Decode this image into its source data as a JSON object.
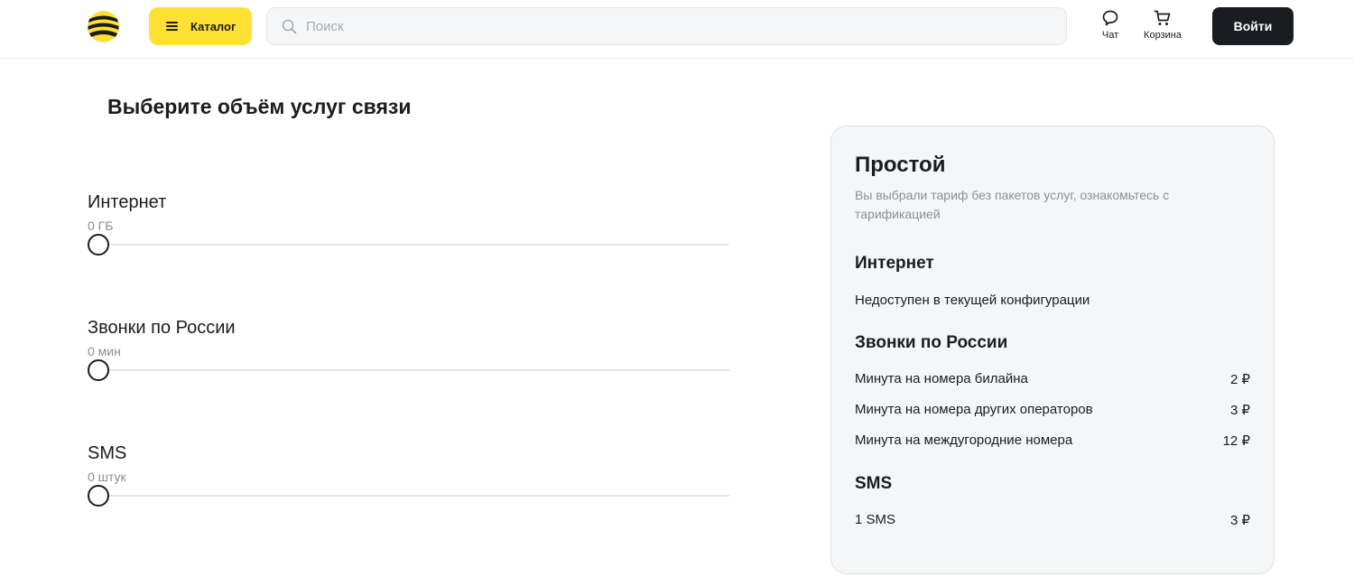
{
  "header": {
    "catalog_label": "Каталог",
    "search_placeholder": "Поиск",
    "chat_label": "Чат",
    "cart_label": "Корзина",
    "login_label": "Войти",
    "brand_colors": {
      "yellow": "#ffe033",
      "black": "#191c20"
    }
  },
  "main": {
    "title": "Выберите объём услуг связи",
    "sliders": [
      {
        "name": "Интернет",
        "value": "0 ГБ",
        "level": 0
      },
      {
        "name": "Звонки по России",
        "value": "0 мин",
        "level": 0
      },
      {
        "name": "SMS",
        "value": "0 штук",
        "level": 0
      }
    ]
  },
  "summary": {
    "title": "Простой",
    "subtitle": "Вы выбрали тариф без пакетов услуг, ознакомьтесь с тарификацией",
    "internet": {
      "heading": "Интернет",
      "note": "Недоступен в текущей конфигурации"
    },
    "calls": {
      "heading": "Звонки по России",
      "rows": [
        {
          "label": "Минута на номера билайна",
          "price": "2 ₽"
        },
        {
          "label": "Минута на номера других операторов",
          "price": "3 ₽"
        },
        {
          "label": "Минута на междугородние номера",
          "price": "12 ₽"
        }
      ]
    },
    "sms": {
      "heading": "SMS",
      "rows": [
        {
          "label": "1 SMS",
          "price": "3 ₽"
        }
      ]
    }
  }
}
